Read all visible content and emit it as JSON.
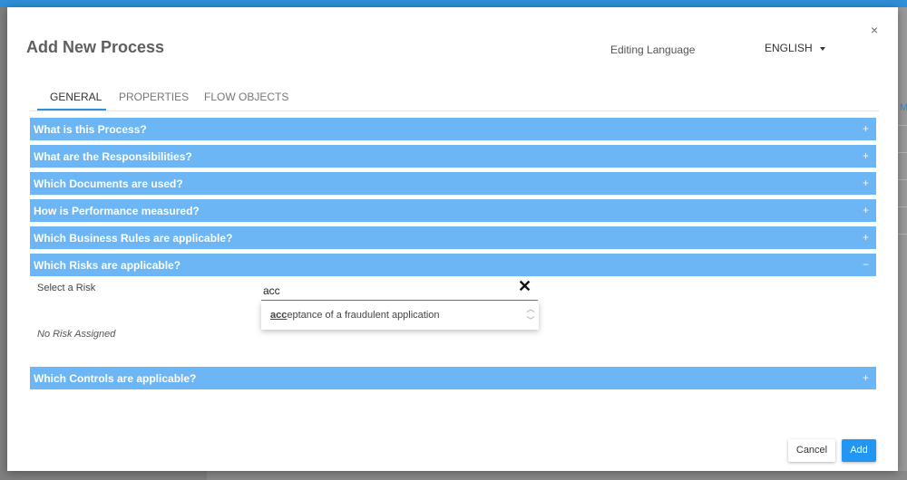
{
  "dialog": {
    "title": "Add New Process",
    "close_label": "×",
    "editing_language_label": "Editing Language",
    "language_value": "ENGLISH"
  },
  "tabs": [
    {
      "label": "GENERAL",
      "active": true
    },
    {
      "label": "PROPERTIES",
      "active": false
    },
    {
      "label": "FLOW OBJECTS",
      "active": false
    }
  ],
  "panels": [
    {
      "label": "What is this Process?",
      "icon": "+"
    },
    {
      "label": "What are the Responsibilities?",
      "icon": "+"
    },
    {
      "label": "Which Documents are used?",
      "icon": "+"
    },
    {
      "label": "How is Performance measured?",
      "icon": "+"
    },
    {
      "label": "Which Business Rules are applicable?",
      "icon": "+"
    },
    {
      "label": "Which Risks are applicable?",
      "icon": "−"
    },
    {
      "label": "Which Controls are applicable?",
      "icon": "+"
    }
  ],
  "risk_section": {
    "select_label": "Select a Risk",
    "input_value": "acc",
    "clear_label": "✕",
    "suggestion_match": "acc",
    "suggestion_rest": "eptance of a fraudulent application",
    "empty_text": "No Risk Assigned"
  },
  "buttons": {
    "cancel": "Cancel",
    "add": "Add"
  },
  "colors": {
    "accent": "#2f8fd8",
    "panel_header": "#6cb6f5",
    "add_button": "#2196f3"
  }
}
